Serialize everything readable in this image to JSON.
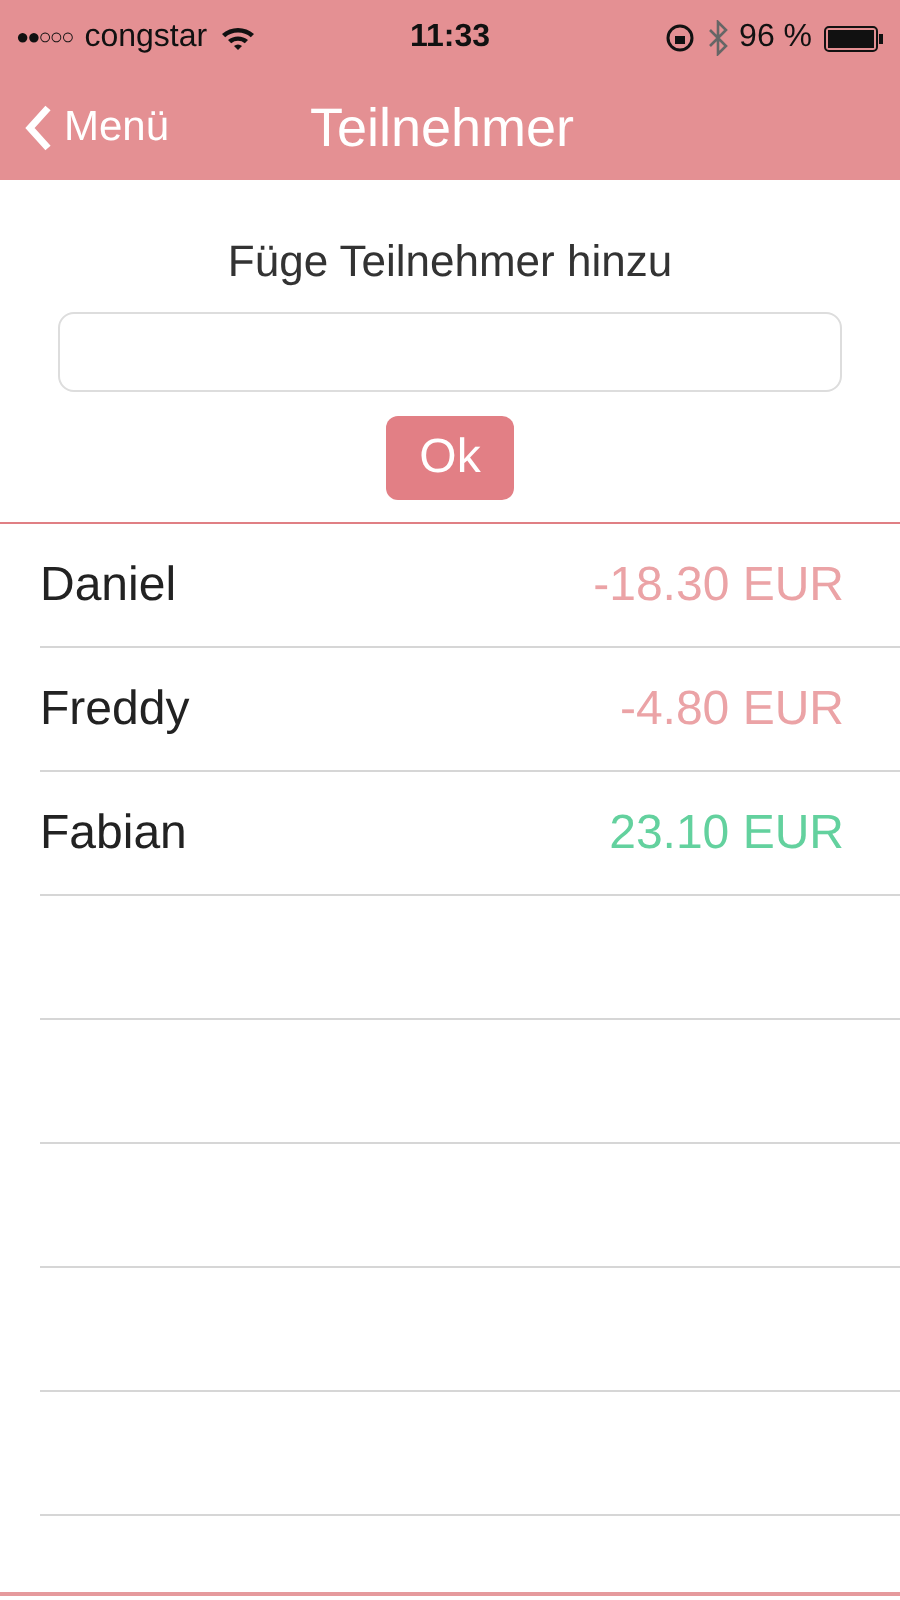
{
  "status_bar": {
    "signal_dots": "●●○○○",
    "carrier": "congstar",
    "time": "11:33",
    "battery": "96 %"
  },
  "nav": {
    "back": "Menü",
    "title": "Teilnehmer"
  },
  "form": {
    "heading": "Füge Teilnehmer hinzu",
    "button": "Ok"
  },
  "participants": [
    {
      "name": "Daniel",
      "balance": "-18.30 EUR",
      "color": "#eba3a6"
    },
    {
      "name": "Freddy",
      "balance": "-4.80 EUR",
      "color": "#eba3a6"
    },
    {
      "name": "Fabian",
      "balance": "23.10 EUR",
      "color": "#63d19e"
    }
  ]
}
